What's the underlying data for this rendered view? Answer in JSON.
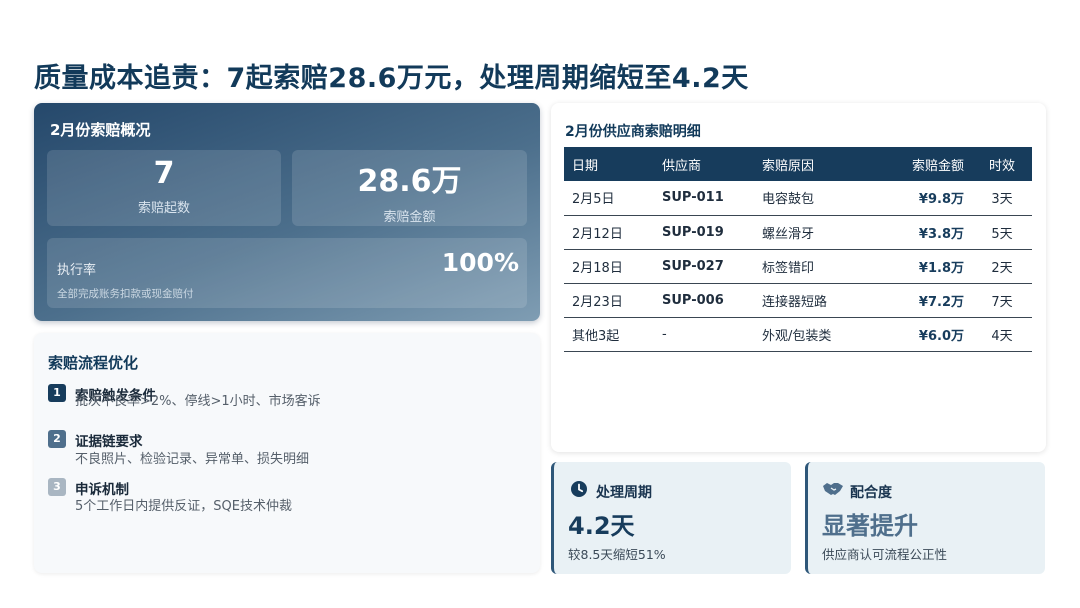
{
  "title": "质量成本追责：7起索赔28.6万元，处理周期缩短至4.2天",
  "overview": {
    "title": "2月份索赔概况",
    "count_value": "7",
    "count_label": "索赔起数",
    "amount_value": "28.6万",
    "amount_label": "索赔金额",
    "exec_label": "执行率",
    "exec_sub": "全部完成账务扣款或现金赔付",
    "exec_value": "100%"
  },
  "process": {
    "title": "索赔流程优化",
    "steps": [
      {
        "num": "1",
        "title": "索赔触发条件",
        "desc": "批次不良率>2%、停线>1小时、市场客诉"
      },
      {
        "num": "2",
        "title": "证据链要求",
        "desc": "不良照片、检验记录、异常单、损失明细"
      },
      {
        "num": "3",
        "title": "申诉机制",
        "desc": "5个工作日内提供反证，SQE技术仲裁"
      }
    ]
  },
  "detail": {
    "title": "2月份供应商索赔明细",
    "columns": [
      "日期",
      "供应商",
      "索赔原因",
      "索赔金额",
      "时效"
    ],
    "rows": [
      [
        "2月5日",
        "SUP-011",
        "电容鼓包",
        "¥9.8万",
        "3天"
      ],
      [
        "2月12日",
        "SUP-019",
        "螺丝滑牙",
        "¥3.8万",
        "5天"
      ],
      [
        "2月18日",
        "SUP-027",
        "标签错印",
        "¥1.8万",
        "2天"
      ],
      [
        "2月23日",
        "SUP-006",
        "连接器短路",
        "¥7.2万",
        "7天"
      ],
      [
        "其他3起",
        "-",
        "外观/包装类",
        "¥6.0万",
        "4天"
      ]
    ]
  },
  "metrics": [
    {
      "icon": "clock-icon",
      "label": "处理周期",
      "value": "4.2天",
      "sub": "较8.5天缩短51%"
    },
    {
      "icon": "handshake-icon",
      "label": "配合度",
      "value": "显著提升",
      "sub": "供应商认可流程公正性"
    }
  ],
  "colors": {
    "primary": "#173c5c",
    "step1": "#173c5c",
    "step2": "#4f6f8c",
    "step3": "#a9b6c2",
    "metric_bg": "#e9f1f5"
  }
}
